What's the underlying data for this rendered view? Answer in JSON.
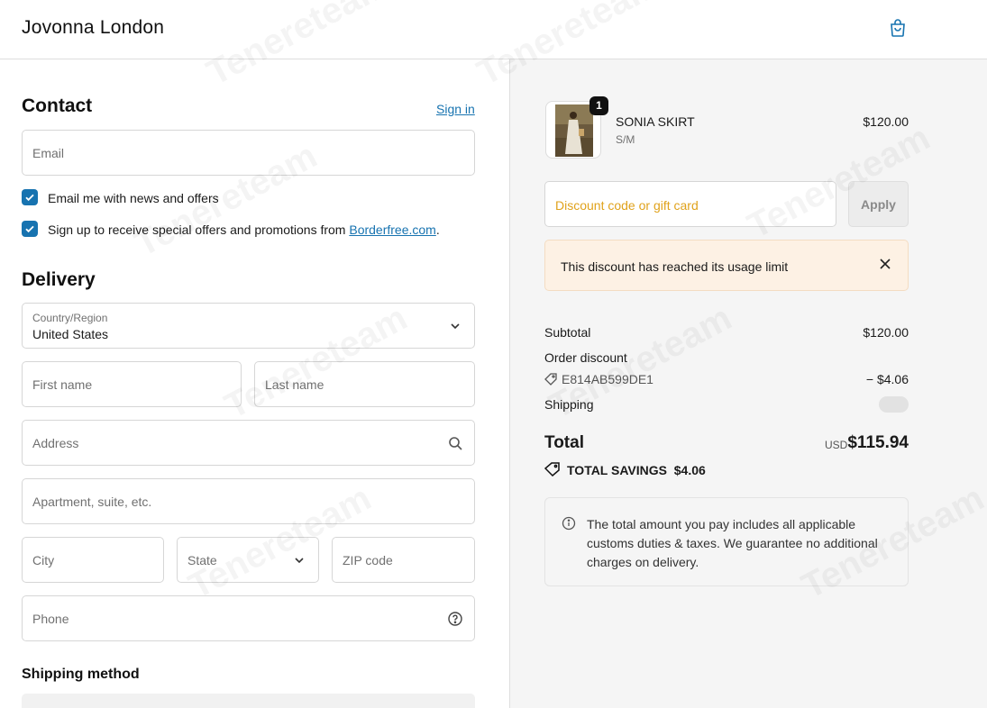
{
  "header": {
    "brand": "Jovonna London",
    "cart_icon": "shopping-bag-icon"
  },
  "contact": {
    "title": "Contact",
    "sign_in": "Sign in",
    "email_placeholder": "Email",
    "news_label": "Email me with news and offers",
    "promo_label_prefix": "Sign up to receive special offers and promotions from ",
    "promo_link": "Borderfree.com",
    "promo_label_suffix": "."
  },
  "delivery": {
    "title": "Delivery",
    "country_label": "Country/Region",
    "country_value": "United States",
    "first_name": "First name",
    "last_name": "Last name",
    "address": "Address",
    "apartment": "Apartment, suite, etc.",
    "city": "City",
    "state": "State",
    "zip": "ZIP code",
    "phone": "Phone"
  },
  "shipping_method": {
    "title": "Shipping method"
  },
  "order": {
    "item": {
      "name": "SONIA SKIRT",
      "variant": "S/M",
      "price": "$120.00",
      "quantity": "1"
    },
    "discount_placeholder": "Discount code or gift card",
    "apply_label": "Apply",
    "alert": "This discount has reached its usage limit",
    "subtotal_label": "Subtotal",
    "subtotal_value": "$120.00",
    "order_discount_label": "Order discount",
    "discount_code": "E814AB599DE1",
    "discount_value": "− $4.06",
    "shipping_label": "Shipping",
    "total_label": "Total",
    "currency": "USD",
    "total_value": "$115.94",
    "savings_label": "TOTAL SAVINGS",
    "savings_value": "$4.06",
    "info_text": "The total amount you pay includes all applicable customs duties & taxes. We guarantee no additional charges on delivery."
  },
  "watermark": "Tenereteam",
  "colors": {
    "accent": "#1773b0",
    "alert_bg": "#fdf1e4",
    "discount_placeholder": "#e0a21b"
  }
}
